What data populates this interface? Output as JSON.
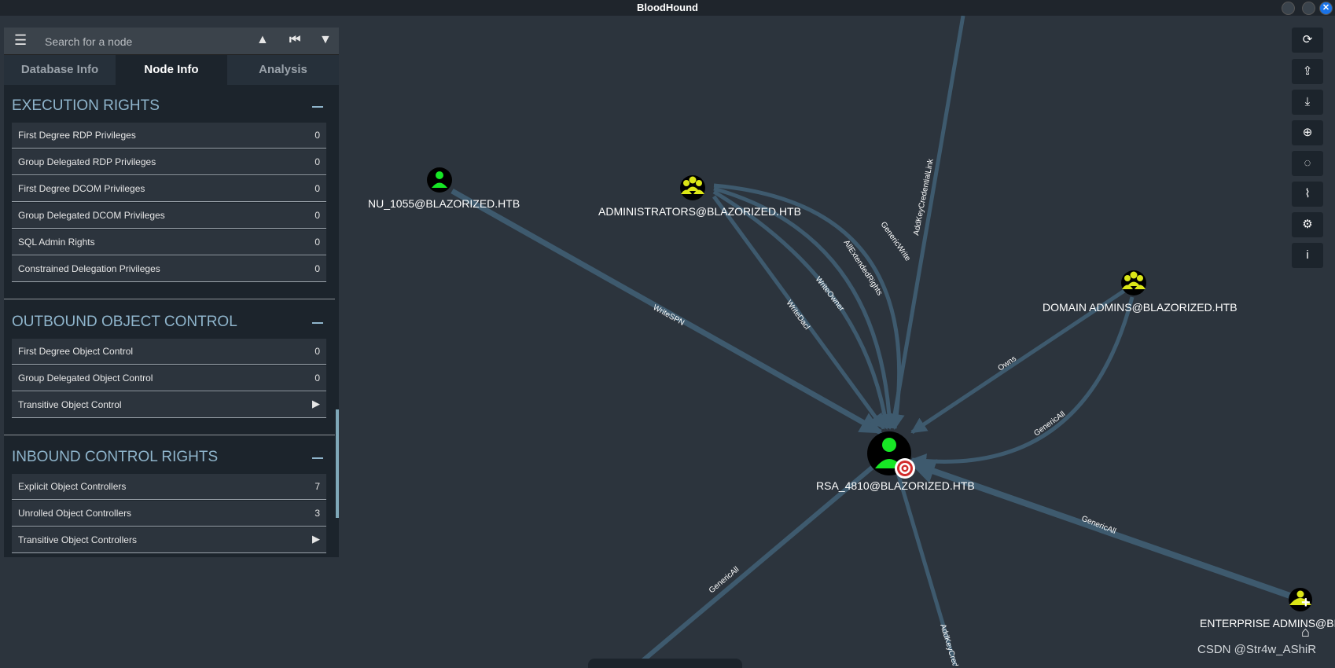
{
  "window": {
    "title": "BloodHound"
  },
  "search": {
    "placeholder": "Search for a node",
    "menu_icon": "menu-icon",
    "pathfinding_icon": "pathfinding-icon",
    "back_icon": "back-icon",
    "filter_icon": "filter-icon"
  },
  "tabs": [
    {
      "label": "Database Info",
      "active": false
    },
    {
      "label": "Node Info",
      "active": true
    },
    {
      "label": "Analysis",
      "active": false
    }
  ],
  "sections": {
    "execution": {
      "title": "EXECUTION RIGHTS",
      "rows": [
        {
          "label": "First Degree RDP Privileges",
          "value": "0"
        },
        {
          "label": "Group Delegated RDP Privileges",
          "value": "0"
        },
        {
          "label": "First Degree DCOM Privileges",
          "value": "0"
        },
        {
          "label": "Group Delegated DCOM Privileges",
          "value": "0"
        },
        {
          "label": "SQL Admin Rights",
          "value": "0"
        },
        {
          "label": "Constrained Delegation Privileges",
          "value": "0"
        }
      ]
    },
    "outbound": {
      "title": "OUTBOUND OBJECT CONTROL",
      "rows": [
        {
          "label": "First Degree Object Control",
          "value": "0"
        },
        {
          "label": "Group Delegated Object Control",
          "value": "0"
        },
        {
          "label": "Transitive Object Control",
          "value": "▶"
        }
      ]
    },
    "inbound": {
      "title": "INBOUND CONTROL RIGHTS",
      "rows": [
        {
          "label": "Explicit Object Controllers",
          "value": "7"
        },
        {
          "label": "Unrolled Object Controllers",
          "value": "3"
        },
        {
          "label": "Transitive Object Controllers",
          "value": "▶"
        }
      ]
    }
  },
  "graph": {
    "nodes": {
      "nu": {
        "label": "NU_1055@BLAZORIZED.HTB",
        "type": "user"
      },
      "admins": {
        "label": "ADMINISTRATORS@BLAZORIZED.HTB",
        "type": "group"
      },
      "domain_admins": {
        "label": "DOMAIN ADMINS@BLAZORIZED.HTB",
        "type": "group"
      },
      "rsa": {
        "label": "RSA_4810@BLAZORIZED.HTB",
        "type": "user",
        "target": true
      },
      "enterprise": {
        "label": "ENTERPRISE ADMINS@BLA",
        "type": "group"
      }
    },
    "edges": {
      "writespn": "WriteSPN",
      "writedacl": "WriteDacl",
      "writeowner": "WriteOwner",
      "allextended": "AllExtendedRights",
      "genericwrite": "GenericWrite",
      "addkey_top": "AddKeyCredentialLink",
      "owns": "Owns",
      "genericall_da": "GenericAll",
      "genericall_ea": "GenericAll",
      "genericall_bl": "GenericAll",
      "addkey_bottom": "AddKeyCred"
    }
  },
  "right_toolbar": [
    "refresh-icon",
    "upload-icon",
    "download-icon",
    "import-icon",
    "layout-icon",
    "chart-icon",
    "settings-icon",
    "info-icon"
  ],
  "zoom": {
    "plus": "+",
    "home_icon": "home-icon"
  },
  "watermark": "CSDN @Str4w_AShiR",
  "colors": {
    "edge": "#3e5a6e",
    "user_node": "#17e625",
    "group_node": "#dbe617",
    "target": "#d12c2c",
    "section_header": "#8fb5cc"
  }
}
